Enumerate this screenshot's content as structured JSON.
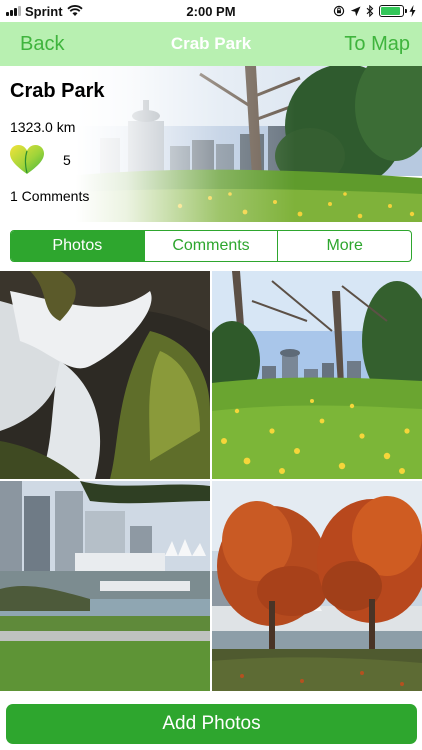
{
  "status_bar": {
    "carrier": "Sprint",
    "time": "2:00 PM",
    "icons": [
      "signal-icon",
      "wifi-icon",
      "lock-rotation-icon",
      "location-icon",
      "bluetooth-icon",
      "battery-icon",
      "charging-icon"
    ],
    "battery_level": 0.9
  },
  "nav": {
    "back_label": "Back",
    "title": "Crab Park",
    "map_label": "To Map"
  },
  "park": {
    "name": "Crab Park",
    "distance": "1323.0 km",
    "likes": "5",
    "comments": "1 Comments"
  },
  "tabs": [
    {
      "label": "Photos",
      "active": true
    },
    {
      "label": "Comments",
      "active": false
    },
    {
      "label": "More",
      "active": false
    }
  ],
  "photos": [
    {
      "subject": "waterfall-photo"
    },
    {
      "subject": "park-lawn-photo"
    },
    {
      "subject": "harbour-skyline-photo"
    },
    {
      "subject": "autumn-trees-photo"
    }
  ],
  "add_photos_label": "Add Photos",
  "colors": {
    "accent": "#2ea62e",
    "nav_bg": "#b8f0b1",
    "nav_button": "#3fb43d"
  }
}
